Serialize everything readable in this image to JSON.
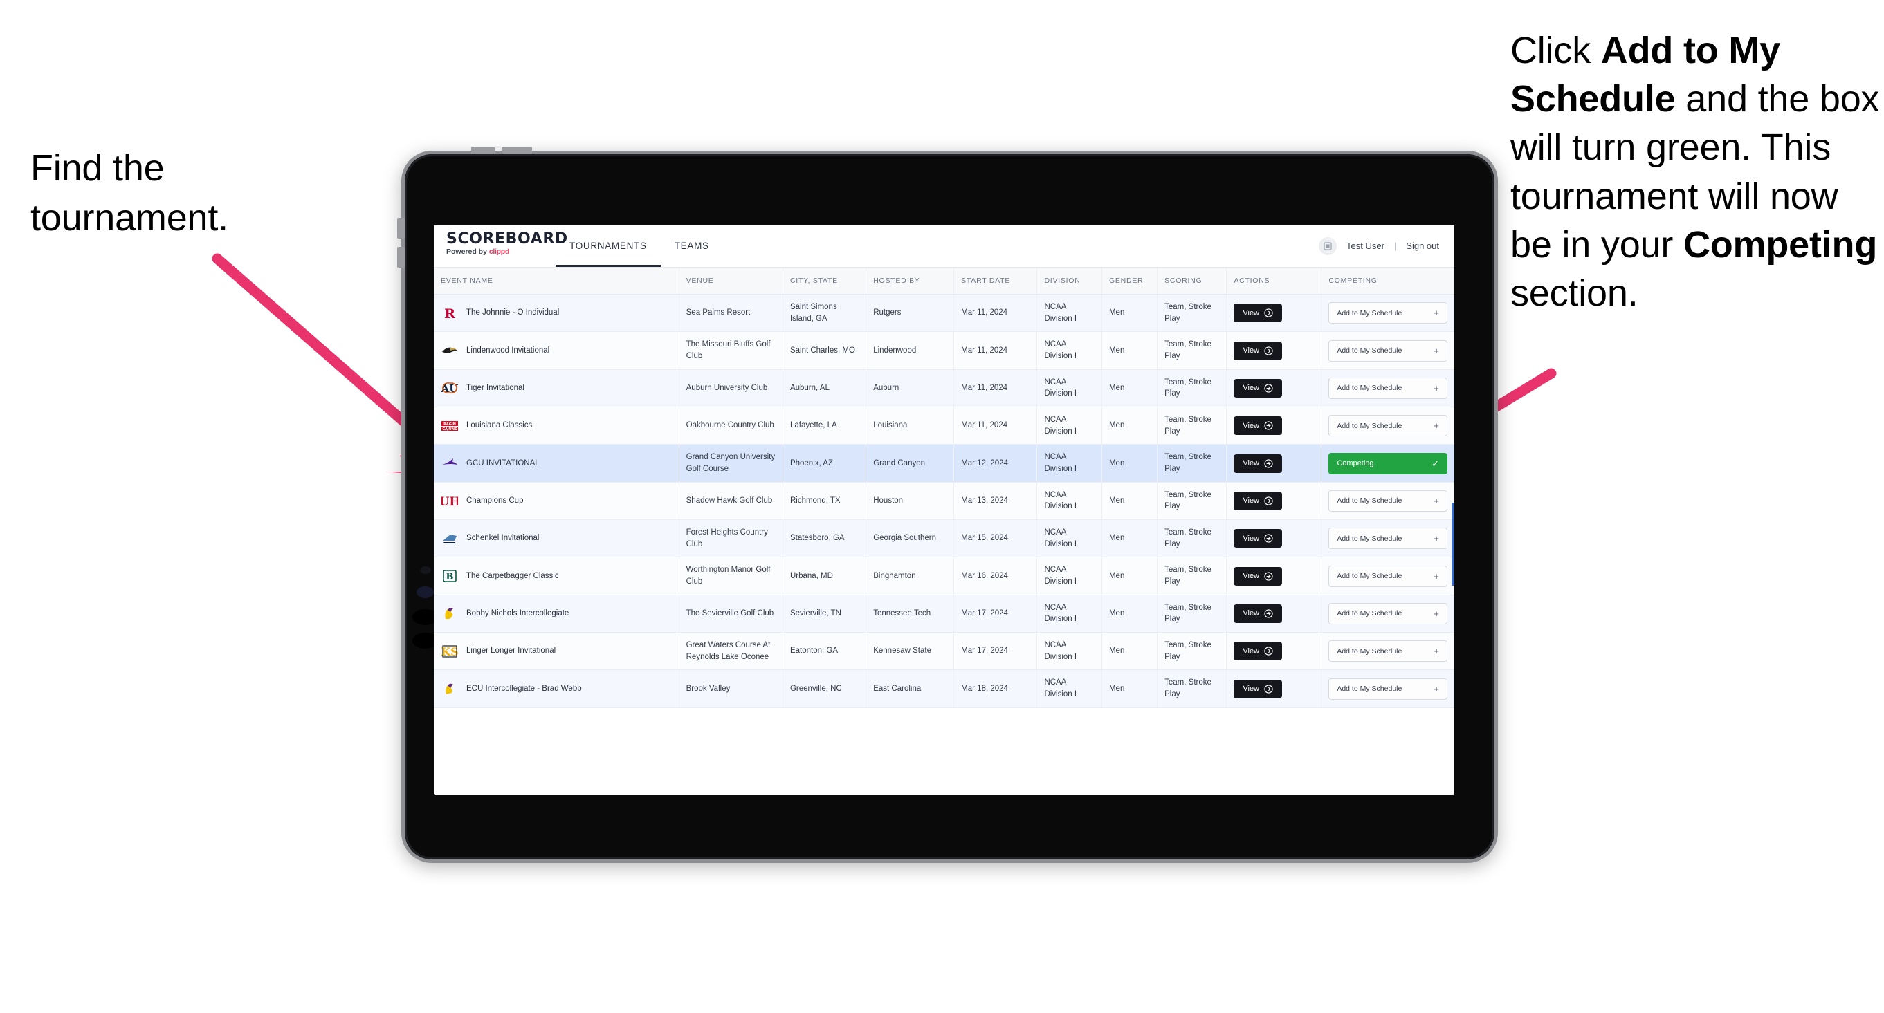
{
  "annotations": {
    "left": {
      "line1": "Find the",
      "line2": "tournament."
    },
    "right": {
      "p1_pre": "Click ",
      "p1_bold": "Add to My Schedule",
      "p1_post": " and the box will turn green. This tournament will now be in your ",
      "p2_bold": "Competing",
      "p2_post": " section."
    },
    "arrow_color": "#e8336c"
  },
  "app": {
    "brand": {
      "title": "SCOREBOARD",
      "sub_prefix": "Powered by ",
      "sub_brand": "clippd"
    },
    "nav": [
      {
        "label": "TOURNAMENTS",
        "active": true
      },
      {
        "label": "TEAMS",
        "active": false
      }
    ],
    "user": {
      "name": "Test User",
      "separator": "|",
      "signout": "Sign out",
      "avatar_icon": "user-avatar-icon"
    }
  },
  "table": {
    "columns": [
      "EVENT NAME",
      "VENUE",
      "CITY, STATE",
      "HOSTED BY",
      "START DATE",
      "DIVISION",
      "GENDER",
      "SCORING",
      "ACTIONS",
      "COMPETING"
    ],
    "action_labels": {
      "view": "View",
      "add": "Add to My Schedule",
      "plus": "+",
      "competing": "Competing",
      "check": "✓"
    },
    "rows": [
      {
        "logo": "rutgers-logo",
        "event": "The Johnnie - O Individual",
        "venue": "Sea Palms Resort",
        "city": "Saint Simons Island, GA",
        "host": "Rutgers",
        "date": "Mar 11, 2024",
        "division": "NCAA Division I",
        "gender": "Men",
        "scoring": "Team, Stroke Play",
        "competing": false,
        "selected": false
      },
      {
        "logo": "lindenwood-logo",
        "event": "Lindenwood Invitational",
        "venue": "The Missouri Bluffs Golf Club",
        "city": "Saint Charles, MO",
        "host": "Lindenwood",
        "date": "Mar 11, 2024",
        "division": "NCAA Division I",
        "gender": "Men",
        "scoring": "Team, Stroke Play",
        "competing": false,
        "selected": false
      },
      {
        "logo": "auburn-logo",
        "event": "Tiger Invitational",
        "venue": "Auburn University Club",
        "city": "Auburn, AL",
        "host": "Auburn",
        "date": "Mar 11, 2024",
        "division": "NCAA Division I",
        "gender": "Men",
        "scoring": "Team, Stroke Play",
        "competing": false,
        "selected": false
      },
      {
        "logo": "louisiana-logo",
        "event": "Louisiana Classics",
        "venue": "Oakbourne Country Club",
        "city": "Lafayette, LA",
        "host": "Louisiana",
        "date": "Mar 11, 2024",
        "division": "NCAA Division I",
        "gender": "Men",
        "scoring": "Team, Stroke Play",
        "competing": false,
        "selected": false
      },
      {
        "logo": "gcu-logo",
        "event": "GCU INVITATIONAL",
        "venue": "Grand Canyon University Golf Course",
        "city": "Phoenix, AZ",
        "host": "Grand Canyon",
        "date": "Mar 12, 2024",
        "division": "NCAA Division I",
        "gender": "Men",
        "scoring": "Team, Stroke Play",
        "competing": true,
        "selected": true
      },
      {
        "logo": "houston-logo",
        "event": "Champions Cup",
        "venue": "Shadow Hawk Golf Club",
        "city": "Richmond, TX",
        "host": "Houston",
        "date": "Mar 13, 2024",
        "division": "NCAA Division I",
        "gender": "Men",
        "scoring": "Team, Stroke Play",
        "competing": false,
        "selected": false
      },
      {
        "logo": "georgia-southern-logo",
        "event": "Schenkel Invitational",
        "venue": "Forest Heights Country Club",
        "city": "Statesboro, GA",
        "host": "Georgia Southern",
        "date": "Mar 15, 2024",
        "division": "NCAA Division I",
        "gender": "Men",
        "scoring": "Team, Stroke Play",
        "competing": false,
        "selected": false
      },
      {
        "logo": "binghamton-logo",
        "event": "The Carpetbagger Classic",
        "venue": "Worthington Manor Golf Club",
        "city": "Urbana, MD",
        "host": "Binghamton",
        "date": "Mar 16, 2024",
        "division": "NCAA Division I",
        "gender": "Men",
        "scoring": "Team, Stroke Play",
        "competing": false,
        "selected": false
      },
      {
        "logo": "tennessee-tech-logo",
        "event": "Bobby Nichols Intercollegiate",
        "venue": "The Sevierville Golf Club",
        "city": "Sevierville, TN",
        "host": "Tennessee Tech",
        "date": "Mar 17, 2024",
        "division": "NCAA Division I",
        "gender": "Men",
        "scoring": "Team, Stroke Play",
        "competing": false,
        "selected": false
      },
      {
        "logo": "kennesaw-state-logo",
        "event": "Linger Longer Invitational",
        "venue": "Great Waters Course At Reynolds Lake Oconee",
        "city": "Eatonton, GA",
        "host": "Kennesaw State",
        "date": "Mar 17, 2024",
        "division": "NCAA Division I",
        "gender": "Men",
        "scoring": "Team, Stroke Play",
        "competing": false,
        "selected": false
      },
      {
        "logo": "ecu-logo",
        "event": "ECU Intercollegiate - Brad Webb",
        "venue": "Brook Valley",
        "city": "Greenville, NC",
        "host": "East Carolina",
        "date": "Mar 18, 2024",
        "division": "NCAA Division I",
        "gender": "Men",
        "scoring": "Team, Stroke Play",
        "competing": false,
        "selected": false
      }
    ]
  }
}
